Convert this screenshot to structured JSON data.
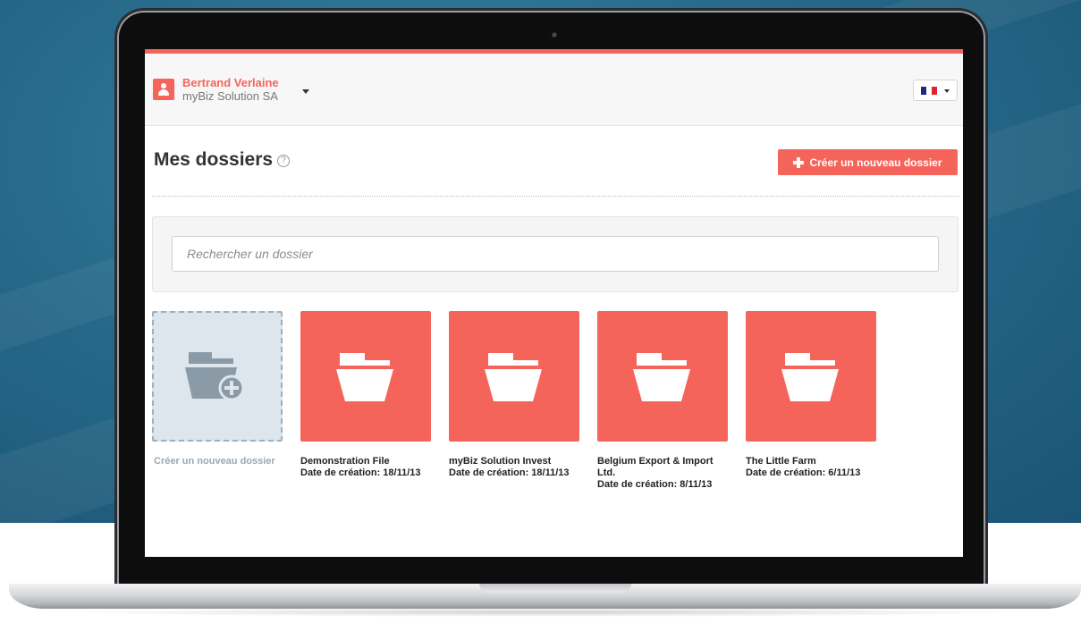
{
  "header": {
    "user_name": "Bertrand Verlaine",
    "user_company": "myBiz Solution SA",
    "language_flag": "fr-flag-icon"
  },
  "page": {
    "title": "Mes dossiers",
    "help_glyph": "?",
    "create_button_label": "Créer un nouveau dossier"
  },
  "search": {
    "placeholder": "Rechercher un dossier"
  },
  "new_folder_tile": {
    "label": "Créer un nouveau dossier",
    "icon": "folder-add-icon"
  },
  "folders": [
    {
      "name": "Demonstration File",
      "date": "Date de création: 18/11/13",
      "icon": "folder-icon"
    },
    {
      "name": "myBiz Solution Invest",
      "date": "Date de création: 18/11/13",
      "icon": "folder-icon"
    },
    {
      "name": "Belgium Export & Import Ltd.",
      "date": "Date de création: 8/11/13",
      "icon": "folder-icon"
    },
    {
      "name": "The Little Farm",
      "date": "Date de création: 6/11/13",
      "icon": "folder-icon"
    }
  ],
  "colors": {
    "accent": "#f5645b",
    "tile_new_bg": "#dde6ec",
    "tile_new_icon": "#8a9ba7",
    "flag_blue": "#1d2a80",
    "flag_white": "#ffffff",
    "flag_red": "#e0242d"
  }
}
